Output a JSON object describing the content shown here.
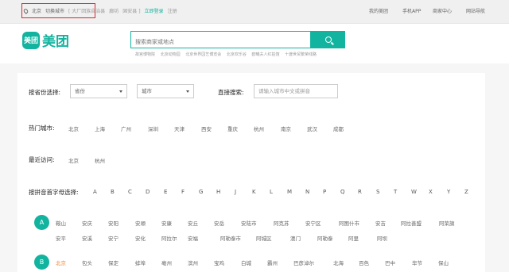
{
  "topbar": {
    "location": "北京",
    "switch_city": "切换城市",
    "nearby": "[ 大厂回族自治县",
    "nearby2": "廊坊",
    "nearby3": "固安县 ]",
    "login": "立即登录",
    "register": "注册",
    "my_meituan": "我的美团",
    "mobile_app": "手机APP",
    "merchant": "商家中心",
    "site_nav": "网站导航"
  },
  "logo": {
    "icon": "美团",
    "text": "美团"
  },
  "search": {
    "placeholder": "搜索商家或地点",
    "hot": [
      "故宫博物院",
      "北京动物园",
      "北京世界园艺博览会",
      "北京欢乐谷",
      "欧曦夫人红拍馆",
      "十渡世贸繁荣线路"
    ]
  },
  "filters": {
    "province_label": "按省份选择:",
    "province_value": "省份",
    "city_value": "城市",
    "direct_label": "直接搜索:",
    "direct_placeholder": "请输入城市中文或拼音"
  },
  "hot_cities": {
    "label": "热门城市:",
    "items": [
      "北京",
      "上海",
      "广州",
      "深圳",
      "天津",
      "西安",
      "重庆",
      "杭州",
      "南京",
      "武汉",
      "成都"
    ]
  },
  "recent": {
    "label": "最近访问:",
    "items": [
      "北京",
      "杭州"
    ]
  },
  "alphabet": {
    "label": "按拼音首字母选择:",
    "letters": [
      "A",
      "B",
      "C",
      "D",
      "E",
      "F",
      "G",
      "H",
      "J",
      "K",
      "L",
      "M",
      "N",
      "P",
      "Q",
      "R",
      "S",
      "T",
      "W",
      "X",
      "Y",
      "Z"
    ]
  },
  "group_a": {
    "letter": "A",
    "row1": [
      "鞍山",
      "安庆",
      "安阳",
      "安顺",
      "安康",
      "安丘",
      "安岳",
      "安陆市",
      "阿克苏",
      "安宁区",
      "阿图什市",
      "安吉",
      "阿拉善盟",
      "阿荣旗"
    ],
    "row2": [
      "安平",
      "安溪",
      "安宁",
      "安化",
      "阿拉尔",
      "安福",
      "阿勒泰市",
      "阿城区",
      "澳门",
      "阿勒泰",
      "阿里",
      "阿坝"
    ]
  },
  "group_b": {
    "letter": "B",
    "row1": [
      "北京",
      "包头",
      "保定",
      "蚌埠",
      "亳州",
      "滨州",
      "宝鸡",
      "白城",
      "霸州",
      "巴彦淖尔",
      "北海",
      "百色",
      "巴中",
      "毕节",
      "保山"
    ]
  }
}
